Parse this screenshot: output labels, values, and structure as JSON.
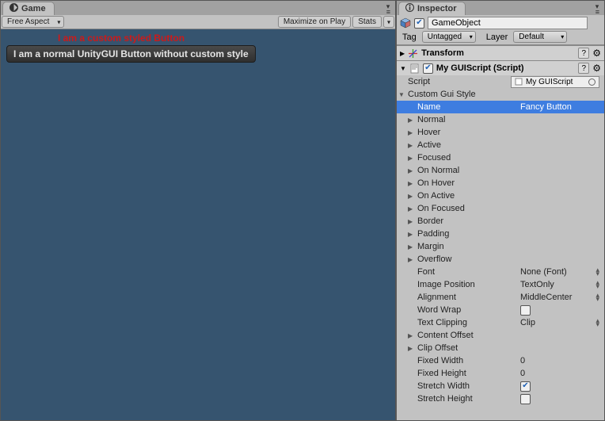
{
  "tabs": {
    "game": "Game",
    "inspector": "Inspector"
  },
  "game_toolbar": {
    "aspect": "Free Aspect",
    "maximize": "Maximize on Play",
    "stats": "Stats"
  },
  "gameview": {
    "fancy_button_text": "I am a custom styled Button",
    "normal_button_text": "I am a normal UnityGUI Button without custom style"
  },
  "inspector": {
    "name": "GameObject",
    "enabled": true,
    "tag_label": "Tag",
    "tag_value": "Untagged",
    "layer_label": "Layer",
    "layer_value": "Default",
    "transform_title": "Transform",
    "script_component": {
      "title": "My GUIScript (Script)",
      "script_label": "Script",
      "script_value": "My GUIScript",
      "group_label": "Custom Gui Style",
      "name_label": "Name",
      "name_value": "Fancy Button",
      "states": [
        "Normal",
        "Hover",
        "Active",
        "Focused",
        "On Normal",
        "On Hover",
        "On Active",
        "On Focused",
        "Border",
        "Padding",
        "Margin",
        "Overflow"
      ],
      "font_label": "Font",
      "font_value": "None (Font)",
      "image_position_label": "Image Position",
      "image_position_value": "TextOnly",
      "alignment_label": "Alignment",
      "alignment_value": "MiddleCenter",
      "word_wrap_label": "Word Wrap",
      "word_wrap_value": false,
      "text_clipping_label": "Text Clipping",
      "text_clipping_value": "Clip",
      "content_offset_label": "Content Offset",
      "clip_offset_label": "Clip Offset",
      "fixed_width_label": "Fixed Width",
      "fixed_width_value": "0",
      "fixed_height_label": "Fixed Height",
      "fixed_height_value": "0",
      "stretch_width_label": "Stretch Width",
      "stretch_width_value": true,
      "stretch_height_label": "Stretch Height",
      "stretch_height_value": false
    }
  }
}
